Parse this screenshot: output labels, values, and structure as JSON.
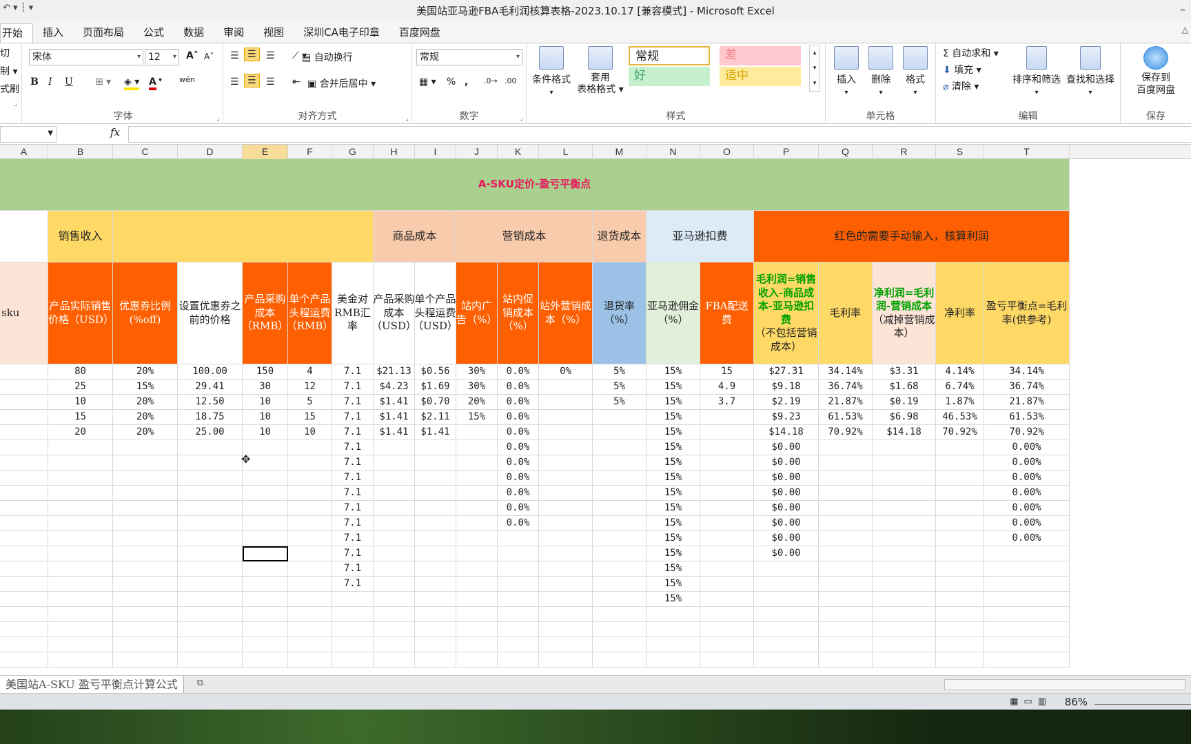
{
  "window": {
    "title": "美国站亚马逊FBA毛利润核算表格-2023.10.17  [兼容模式] - Microsoft Excel",
    "minimize": "–",
    "maximize": "□"
  },
  "ribbon_tabs": [
    "开始",
    "插入",
    "页面布局",
    "公式",
    "数据",
    "审阅",
    "视图",
    "深圳CA电子印章",
    "百度网盘"
  ],
  "clipboard": {
    "cut": "切",
    "copy": "制 ▾",
    "painter": "式刷"
  },
  "font": {
    "group_label": "字体",
    "font_name": "宋体",
    "font_size": "12",
    "bold": "B",
    "italic": "I",
    "underline": "U",
    "font_color_letter": "A",
    "wen": "wén"
  },
  "alignment": {
    "group_label": "对齐方式",
    "wrap_text": "自动换行",
    "merge_center": "合并后居中"
  },
  "number": {
    "group_label": "数字",
    "format": "常规",
    "percent": "%",
    "comma": ","
  },
  "styles": {
    "group_label": "样式",
    "conditional": "条件格式",
    "table_format_line1": "套用",
    "table_format_line2": "表格格式",
    "normal": "常规",
    "bad": "差",
    "good": "好",
    "neutral": "适中"
  },
  "cells_group": {
    "group_label": "单元格",
    "insert": "插入",
    "delete": "删除",
    "format": "格式"
  },
  "editing": {
    "group_label": "编辑",
    "autosum": "自动求和",
    "fill": "填充",
    "clear": "清除",
    "sort_filter": "排序和筛选",
    "find_select": "查找和选择"
  },
  "save_group": {
    "group_label": "保存",
    "save_line1": "保存到",
    "save_line2": "百度网盘"
  },
  "formula_bar": {
    "fx": "fx",
    "name_box": "",
    "formula": ""
  },
  "columns": [
    "A",
    "B",
    "C",
    "D",
    "E",
    "F",
    "G",
    "H",
    "I",
    "J",
    "K",
    "L",
    "M",
    "N",
    "O",
    "P",
    "Q",
    "R",
    "S",
    "T"
  ],
  "banner": "A-SKU定价-盈亏平衡点",
  "group_headers": {
    "sales_income": "销售收入",
    "product_cost": "商品成本",
    "marketing_cost": "营销成本",
    "return_cost": "退货成本",
    "amazon_fee": "亚马逊扣费",
    "manual_note": "红色的需要手动输入，核算利润"
  },
  "headers": {
    "A": "sku",
    "B": "产品实际销售价格（USD）",
    "C": "优惠券比例(%off)",
    "D": "设置优惠券之前的价格",
    "E": "产品采购成本（RMB）",
    "F": "单个产品头程运费（RMB）",
    "G": "美金对RMB汇率",
    "H": "产品采购成本（USD）",
    "I": "单个产品头程运费（USD）",
    "J": "站内广告（%）",
    "K": "站内促销成本（%）",
    "L": "站外营销成本（%）",
    "M": "退货率（%）",
    "N": "亚马逊佣金（%）",
    "O": "FBA配送费",
    "P_main": "毛利润=销售收入-商品成本-亚马逊扣费",
    "P_sub": "（不包括营销成本）",
    "Q": "毛利率",
    "R_main": "净利润=毛利润-营销成本",
    "R_sub": "（减掉营销成本）",
    "S": "净利率",
    "T": "盈亏平衡点=毛利率(供参考)"
  },
  "rows": [
    {
      "B": "80",
      "C": "20%",
      "D": "100.00",
      "E": "150",
      "F": "4",
      "G": "7.1",
      "H": "$21.13",
      "I": "$0.56",
      "J": "30%",
      "K": "0.0%",
      "L": "0%",
      "M": "5%",
      "N": "15%",
      "O": "15",
      "P": "$27.31",
      "Q": "34.14%",
      "R": "$3.31",
      "S": "4.14%",
      "T": "34.14%"
    },
    {
      "B": "25",
      "C": "15%",
      "D": "29.41",
      "E": "30",
      "F": "12",
      "G": "7.1",
      "H": "$4.23",
      "I": "$1.69",
      "J": "30%",
      "K": "0.0%",
      "L": "",
      "M": "5%",
      "N": "15%",
      "O": "4.9",
      "P": "$9.18",
      "Q": "36.74%",
      "R": "$1.68",
      "S": "6.74%",
      "T": "36.74%"
    },
    {
      "B": "10",
      "C": "20%",
      "D": "12.50",
      "E": "10",
      "F": "5",
      "G": "7.1",
      "H": "$1.41",
      "I": "$0.70",
      "J": "20%",
      "K": "0.0%",
      "L": "",
      "M": "5%",
      "N": "15%",
      "O": "3.7",
      "P": "$2.19",
      "Q": "21.87%",
      "R": "$0.19",
      "S": "1.87%",
      "T": "21.87%"
    },
    {
      "B": "15",
      "C": "20%",
      "D": "18.75",
      "E": "10",
      "F": "15",
      "G": "7.1",
      "H": "$1.41",
      "I": "$2.11",
      "J": "15%",
      "K": "0.0%",
      "L": "",
      "M": "",
      "N": "15%",
      "O": "",
      "P": "$9.23",
      "Q": "61.53%",
      "R": "$6.98",
      "S": "46.53%",
      "T": "61.53%"
    },
    {
      "B": "20",
      "C": "20%",
      "D": "25.00",
      "E": "10",
      "F": "10",
      "G": "7.1",
      "H": "$1.41",
      "I": "$1.41",
      "J": "",
      "K": "0.0%",
      "L": "",
      "M": "",
      "N": "15%",
      "O": "",
      "P": "$14.18",
      "Q": "70.92%",
      "R": "$14.18",
      "S": "70.92%",
      "T": "70.92%"
    },
    {
      "G": "7.1",
      "K": "0.0%",
      "N": "15%",
      "P": "$0.00",
      "T": "0.00%"
    },
    {
      "G": "7.1",
      "K": "0.0%",
      "N": "15%",
      "P": "$0.00",
      "T": "0.00%"
    },
    {
      "G": "7.1",
      "K": "0.0%",
      "N": "15%",
      "P": "$0.00",
      "T": "0.00%"
    },
    {
      "G": "7.1",
      "K": "0.0%",
      "N": "15%",
      "P": "$0.00",
      "T": "0.00%"
    },
    {
      "G": "7.1",
      "K": "0.0%",
      "N": "15%",
      "P": "$0.00",
      "T": "0.00%"
    },
    {
      "G": "7.1",
      "K": "0.0%",
      "N": "15%",
      "P": "$0.00",
      "T": "0.00%"
    },
    {
      "G": "7.1",
      "N": "15%",
      "P": "$0.00",
      "T": "0.00%"
    },
    {
      "G": "7.1",
      "N": "15%",
      "P": "$0.00"
    },
    {
      "G": "7.1",
      "N": "15%"
    },
    {
      "G": "7.1",
      "N": "15%"
    },
    {
      "N": "15%"
    }
  ],
  "sheet_tab": "美国站A-SKU 盈亏平衡点计算公式",
  "status": {
    "zoom": "86%"
  },
  "colors": {
    "banner": "#a9d08e",
    "banner_text": "#e8175d",
    "orange_header": "#fe5f00",
    "yellow_header": "#ffd966",
    "peach_header": "#f8cbad",
    "light_peach": "#fce4d6",
    "blue_header": "#9bc2e6",
    "light_blue": "#ddebf7",
    "light_green": "#e2efda",
    "green_text": "#00a000"
  }
}
